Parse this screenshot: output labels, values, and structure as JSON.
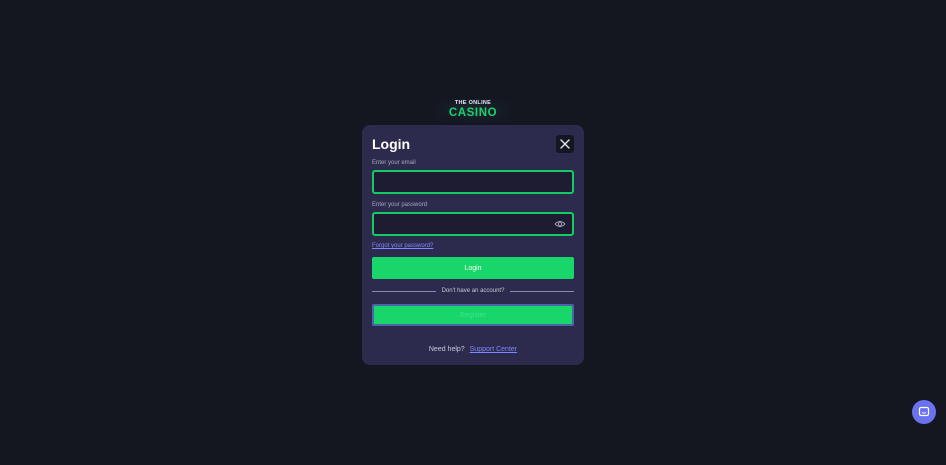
{
  "logo": {
    "line1": "THE ONLINE",
    "line2": "CASINO"
  },
  "login_modal": {
    "title": "Login",
    "email_label": "Enter your email",
    "email_value": "",
    "password_label": "Enter your password",
    "password_value": "",
    "forgot_link": "Forgot your password?",
    "login_button": "Login",
    "divider_text": "Don't have an account?",
    "register_button": "Register",
    "help_text": "Need help?",
    "support_link": "Support Center"
  },
  "icons": {
    "close": "close-icon",
    "show_password": "eye-icon",
    "chat": "chat-icon"
  },
  "colors": {
    "background": "#141620",
    "modal": "#2c2b4d",
    "accent": "#18d66a",
    "link": "#7f88ff",
    "chat_bubble": "#6b72f0"
  }
}
